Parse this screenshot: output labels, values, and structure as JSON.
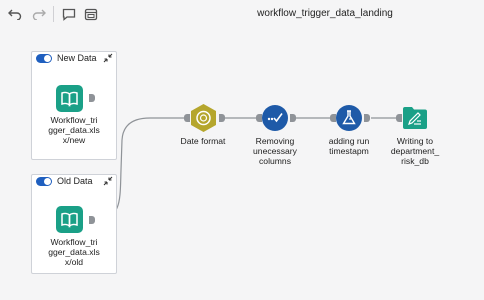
{
  "window": {
    "title": "workflow_trigger_data_landing"
  },
  "colors": {
    "accent": "#1f5fbf",
    "teal": "#1aa087",
    "olive": "#b5a62d",
    "blue": "#1e5aa8"
  },
  "cards": [
    {
      "title": "New Data",
      "node_label_lines": [
        "Workflow_tri",
        "gger_data.xls",
        "x/new"
      ]
    },
    {
      "title": "Old Data",
      "node_label_lines": [
        "Workflow_tri",
        "gger_data.xls",
        "x/old"
      ]
    }
  ],
  "nodes": [
    {
      "label_lines": [
        "Date format"
      ]
    },
    {
      "label_lines": [
        "Removing",
        "unecessary",
        "columns"
      ]
    },
    {
      "label_lines": [
        "adding run",
        "timestapm"
      ]
    },
    {
      "label_lines": [
        "Writing to",
        "department_",
        "risk_db"
      ]
    }
  ],
  "icons": {
    "undo": "undo-icon",
    "redo": "redo-icon",
    "comment": "comment-icon",
    "panel": "panel-icon",
    "collapse": "collapse-icon",
    "book": "book-icon",
    "date": "clock-badge-icon",
    "remove": "check-dots-icon",
    "add": "flask-icon",
    "write": "folder-pen-icon"
  }
}
